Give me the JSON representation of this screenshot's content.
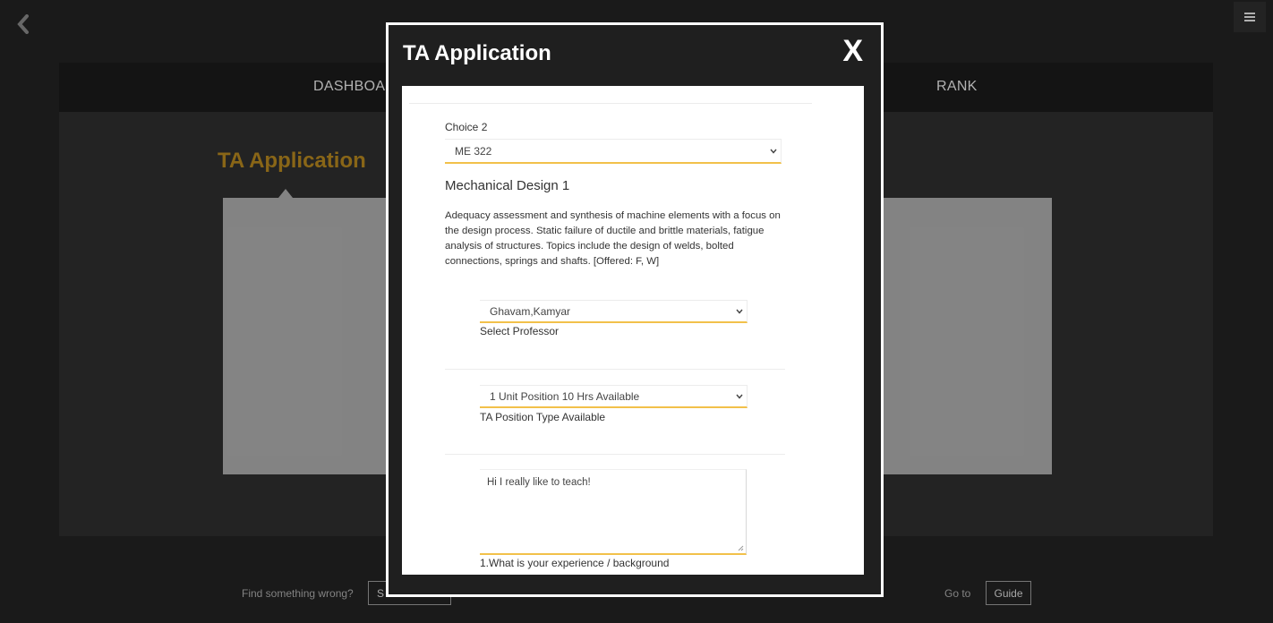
{
  "background": {
    "nav": [
      "DASHBOARD",
      "RANK"
    ],
    "page_title": "TA Application",
    "footer": {
      "report_text": "Find something wrong?",
      "report_button": "S",
      "goto_text": "Go to",
      "guide_button": "Guide"
    }
  },
  "modal": {
    "title": "TA Application",
    "close_label": "X",
    "form": {
      "choice_label": "Choice 2",
      "course_select": "ME 322",
      "course_title": "Mechanical Design 1",
      "course_description": "Adequacy assessment and synthesis of machine elements with a focus on the design process. Static failure of ductile and brittle materials, fatigue analysis of structures. Topics include the design of welds, bolted connections, springs and shafts. [Offered: F, W]",
      "professor_select": "Ghavam,Kamyar",
      "professor_label": "Select Professor",
      "position_select": "1 Unit Position 10 Hrs Available",
      "position_label": "TA Position Type Available",
      "experience_value": "Hi I really like to teach!",
      "experience_label": "1.What is your experience / background"
    }
  },
  "colors": {
    "accent_title": "#a2781c",
    "field_underline": "#f2c14a",
    "modal_border": "#ffffff"
  },
  "icons": [
    "chevron-left-icon",
    "hamburger-menu-icon",
    "chevron-down-icon",
    "resize-handle-icon"
  ]
}
